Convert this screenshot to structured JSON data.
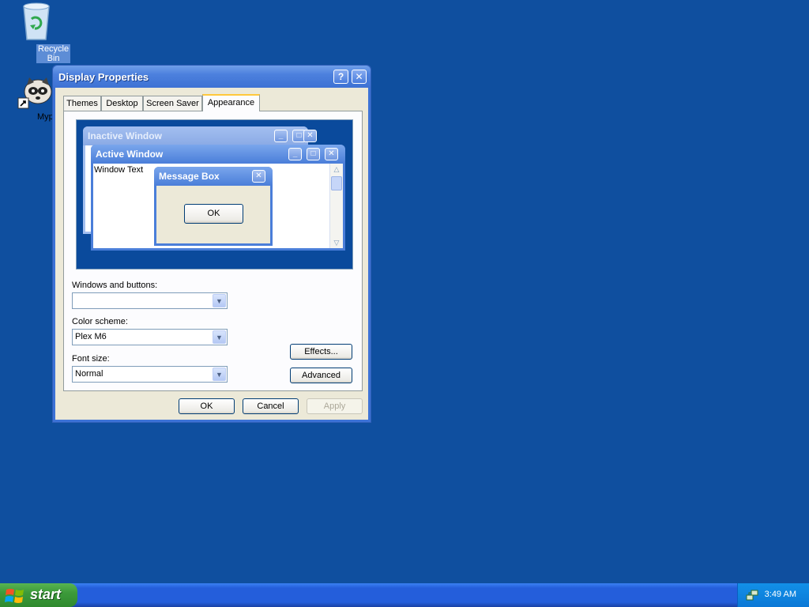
{
  "desktop": {
    "icons": [
      {
        "label": "Recycle Bin",
        "icon": "recycle-bin-icon",
        "selected": true
      },
      {
        "label": "Mypal",
        "icon": "mypal-raccoon-icon",
        "selected": false
      }
    ]
  },
  "dialog": {
    "title": "Display Properties",
    "help_button": "?",
    "close_button": "✕",
    "tabs": [
      {
        "label": "Themes"
      },
      {
        "label": "Desktop"
      },
      {
        "label": "Screen Saver"
      },
      {
        "label": "Appearance",
        "active": true
      }
    ],
    "preview": {
      "inactive_title": "Inactive Window",
      "active_title": "Active Window",
      "window_text": "Window Text",
      "message_title": "Message Box",
      "ok_label": "OK"
    },
    "windows_and_buttons": {
      "label": "Windows and buttons:",
      "value": ""
    },
    "color_scheme": {
      "label": "Color scheme:",
      "value": "Plex M6"
    },
    "font_size": {
      "label": "Font size:",
      "value": "Normal"
    },
    "effects_button": "Effects...",
    "advanced_button": "Advanced",
    "ok_button": "OK",
    "cancel_button": "Cancel",
    "apply_button": "Apply"
  },
  "taskbar": {
    "start_label": "start",
    "clock": "3:49 AM",
    "tray_icon": "network-icon"
  },
  "colors": {
    "desktop": "#0f4f9f",
    "title_bar": "#3e72d4",
    "dialog_face": "#ece9d8",
    "start_button": "#3c9a3a"
  }
}
